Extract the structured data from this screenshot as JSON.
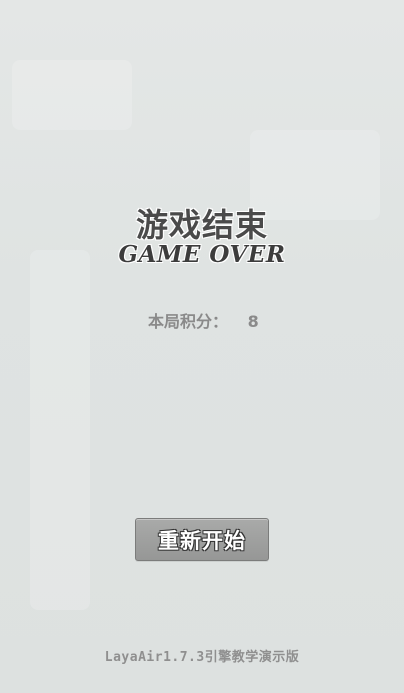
{
  "game_over": {
    "title_cn": "游戏结束",
    "title_en": "GAME OVER"
  },
  "score": {
    "label": "本局积分：",
    "value": "8"
  },
  "buttons": {
    "restart_label": "重新开始"
  },
  "footer": {
    "text": "LayaAir1.7.3引擎教学演示版"
  },
  "colors": {
    "background": "#e1e5e4",
    "title": "#4a4a4a",
    "score_text": "#8a8a8a",
    "button_bg": "#9d9e9d",
    "button_text": "#ffffff"
  }
}
